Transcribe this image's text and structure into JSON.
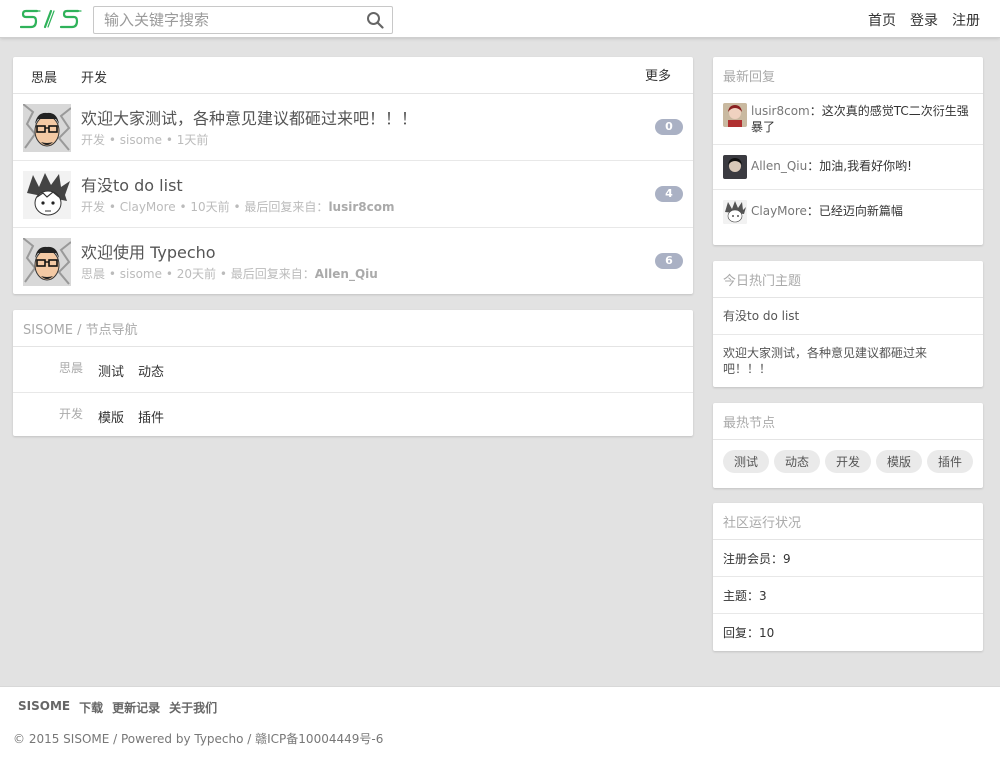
{
  "header": {
    "logo_text": "SIS",
    "search_placeholder": "输入关键字搜索",
    "nav": [
      "首页",
      "登录",
      "注册"
    ]
  },
  "topics_panel": {
    "tabs": [
      "思晨",
      "开发"
    ],
    "more": "更多",
    "topics": [
      {
        "title": "欢迎大家测试，各种意见建议都砸过来吧！！！",
        "category": "开发",
        "author": "sisome",
        "time": "1天前",
        "last_reply_label": "",
        "last_reply_user": "",
        "replies": "0",
        "avatar": "glasses-face"
      },
      {
        "title": "有没to do list",
        "category": "开发",
        "author": "ClayMore",
        "time": "10天前",
        "last_reply_label": "最后回复来自：",
        "last_reply_user": "lusir8com",
        "replies": "4",
        "avatar": "spiky-hair"
      },
      {
        "title": "欢迎使用 Typecho",
        "category": "思晨",
        "author": "sisome",
        "time": "20天前",
        "last_reply_label": "最后回复来自：",
        "last_reply_user": "Allen_Qiu",
        "replies": "6",
        "avatar": "glasses-face"
      }
    ],
    "sep": "•"
  },
  "node_nav": {
    "title": "SISOME / 节点导航",
    "rows": [
      {
        "category": "思晨",
        "nodes": [
          "测试",
          "动态"
        ]
      },
      {
        "category": "开发",
        "nodes": [
          "模版",
          "插件"
        ]
      }
    ]
  },
  "latest_replies": {
    "title": "最新回复",
    "items": [
      {
        "user": "lusir8com",
        "text": "：这次真的感觉TC二次衍生强暴了"
      },
      {
        "user": "Allen_Qiu",
        "text": "：加油,我看好你哟!"
      },
      {
        "user": "ClayMore",
        "text": "：已经迈向新篇幅"
      }
    ]
  },
  "hot_topics": {
    "title": "今日热门主题",
    "items": [
      "有没to do list",
      "欢迎大家测试，各种意见建议都砸过来吧！！！"
    ]
  },
  "hot_nodes": {
    "title": "最热节点",
    "tags": [
      "测试",
      "动态",
      "开发",
      "模版",
      "插件"
    ]
  },
  "stats": {
    "title": "社区运行状况",
    "items": [
      "注册会员：9",
      "主题：3",
      "回复：10"
    ]
  },
  "footer": {
    "links": [
      "SISOME",
      "下载",
      "更新记录",
      "关于我们"
    ],
    "copyright": "© 2015 SISOME / Powered by Typecho / 赣ICP备10004449号-6"
  },
  "colors": {
    "logo_green": "#2fb25a",
    "badge": "#aab1c4"
  }
}
